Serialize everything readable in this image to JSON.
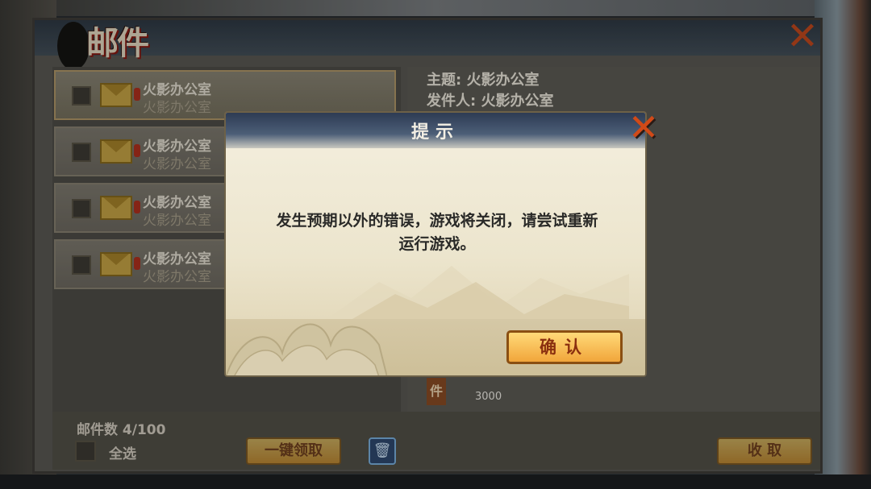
{
  "mail_panel": {
    "title": "邮件",
    "items": [
      {
        "title": "火影办公室",
        "sender": "火影办公室"
      },
      {
        "title": "火影办公室",
        "sender": "火影办公室"
      },
      {
        "title": "火影办公室",
        "sender": "火影办公室"
      },
      {
        "title": "火影办公室",
        "sender": "火影办公室"
      }
    ],
    "detail": {
      "subject": "主题: 火影办公室",
      "sender": "发件人: 火影办公室",
      "attachment_label": "件",
      "attachment_count": "3000"
    },
    "footer": {
      "mail_count": "邮件数 4/100",
      "select_all": "全选",
      "claim_all": "一键领取",
      "collect": "收 取"
    }
  },
  "dialog": {
    "title": "提示",
    "message_line1": "发生预期以外的错误，游戏将关闭，请尝试重新",
    "message_line2": "运行游戏。",
    "confirm": "确认"
  },
  "icons": [
    "close-icon",
    "envelope-icon",
    "trash-icon",
    "checkbox-icon"
  ],
  "colors": {
    "accent_gold": "#f1a63b",
    "close_red": "#d14a18",
    "header_blue": "#2d3b53"
  }
}
